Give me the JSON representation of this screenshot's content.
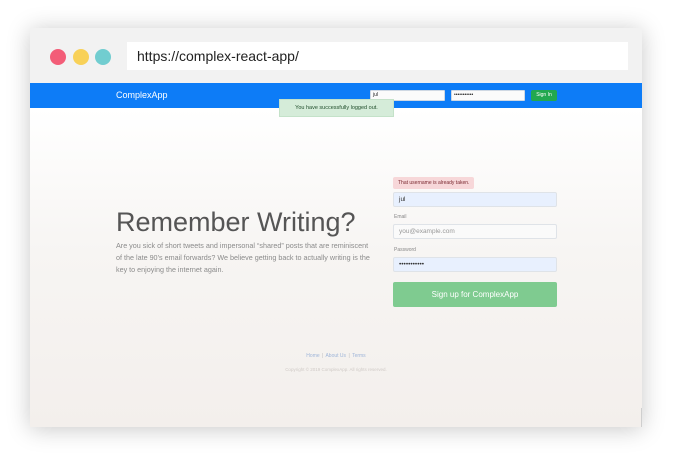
{
  "browser": {
    "url": "https://complex-react-app/"
  },
  "navbar": {
    "brand": "ComplexApp",
    "username_value": "jul",
    "password_value": "•••••••••••",
    "signin_label": "Sign In"
  },
  "flash": {
    "message": "You have successfully logged out."
  },
  "hero": {
    "title": "Remember Writing?",
    "text": "Are you sick of short tweets and impersonal “shared” posts that are reminiscent of the late 90’s email forwards? We believe getting back to actually writing is the key to enjoying the internet again."
  },
  "form": {
    "username_error": "That username is already taken.",
    "username_value": "jul",
    "email_label": "Email",
    "email_placeholder": "you@example.com",
    "password_label": "Password",
    "password_value": "•••••••••••",
    "submit_label": "Sign up for ComplexApp"
  },
  "footer": {
    "home_link": "Home",
    "separator": "|",
    "about_link": "About Us",
    "terms_link": "Terms",
    "copyright": "Copyright © 2019 ComplexApp. All rights reserved."
  },
  "colors": {
    "navbar": "#0d7cf7",
    "signup_button": "#7fcb90",
    "signin_button": "#22a84f",
    "flash_bg": "#d5ecd9",
    "error_bg": "#f7d7d9"
  }
}
